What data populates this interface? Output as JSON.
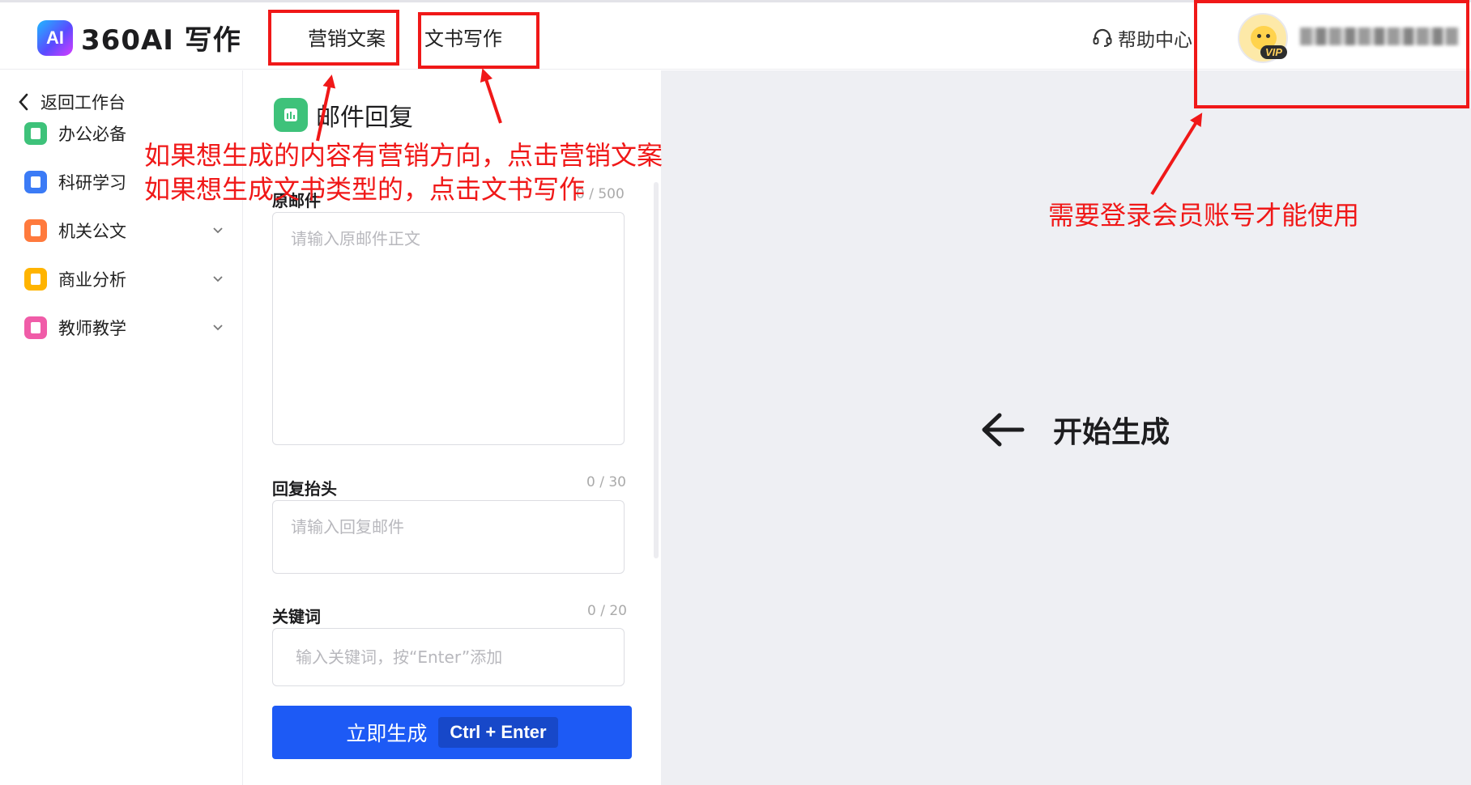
{
  "app": {
    "logo_badge": "AI",
    "logo_text": "360AI 写作"
  },
  "header": {
    "tabs": [
      {
        "label": "营销文案"
      },
      {
        "label": "文书写作"
      }
    ],
    "help_label": "帮助中心",
    "vip_label": "VIP"
  },
  "annotations": {
    "line1": "如果想生成的内容有营销方向，点击营销文案",
    "line2": "如果想生成文书类型的，点击文书写作",
    "account_note": "需要登录会员账号才能使用",
    "color": "#f01818"
  },
  "sidebar": {
    "back_label": "返回工作台",
    "items": [
      {
        "label": "办公必备",
        "icon": "green-doc-icon",
        "color": "#3ec27a",
        "expandable": false
      },
      {
        "label": "科研学习",
        "icon": "blue-doc-icon",
        "color": "#3b7bf6",
        "expandable": false
      },
      {
        "label": "机关公文",
        "icon": "orange-doc-icon",
        "color": "#ff7a3d",
        "expandable": true
      },
      {
        "label": "商业分析",
        "icon": "yellow-doc-icon",
        "color": "#ffb400",
        "expandable": true
      },
      {
        "label": "教师教学",
        "icon": "pink-doc-icon",
        "color": "#f05ca8",
        "expandable": true
      }
    ]
  },
  "form": {
    "title": "邮件回复",
    "fields": [
      {
        "label": "原邮件",
        "count": "0 / 500",
        "placeholder": "请输入原邮件正文"
      },
      {
        "label": "回复抬头",
        "count": "0 / 30",
        "placeholder": "请输入回复邮件"
      },
      {
        "label": "关键词",
        "count": "0 / 20",
        "placeholder": "输入关键词，按“Enter”添加"
      }
    ],
    "generate_label": "立即生成",
    "shortcut_label": "Ctrl + Enter",
    "accent_color": "#1d5af5"
  },
  "output": {
    "start_label": "开始生成"
  }
}
